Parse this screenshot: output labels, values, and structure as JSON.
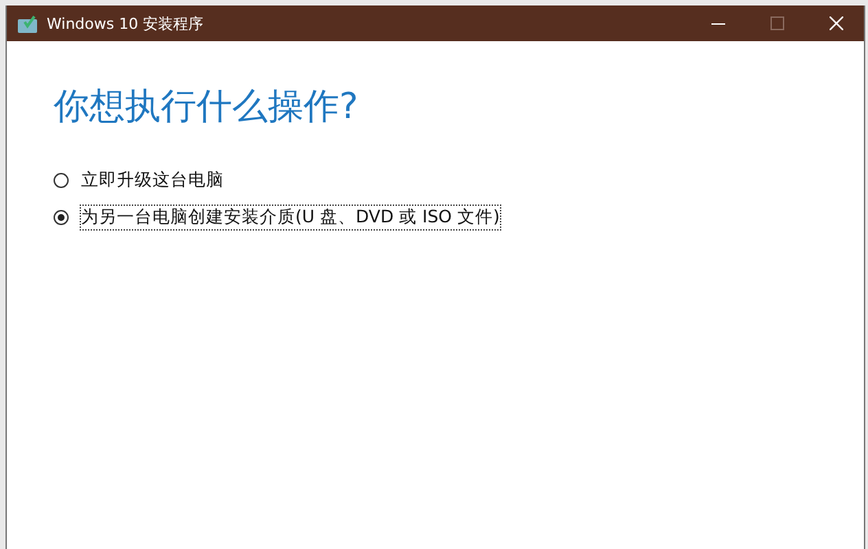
{
  "window": {
    "title": "Windows 10 安装程序"
  },
  "heading": "你想执行什么操作?",
  "options": [
    {
      "label": "立即升级这台电脑",
      "selected": false
    },
    {
      "label": "为另一台电脑创建安装介质(U 盘、DVD 或 ISO 文件)",
      "selected": true
    }
  ]
}
